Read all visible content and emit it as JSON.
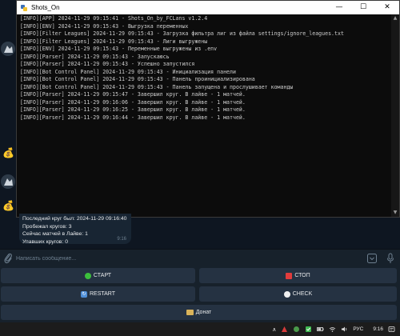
{
  "window": {
    "title": "Shots_On",
    "controls": {
      "minimize": "—",
      "maximize": "☐",
      "close": "✕"
    }
  },
  "console": {
    "lines": [
      "[INFO][APP] 2024-11-29 09:15:41 - Shots_On_by_FCLans v1.2.4",
      "[INFO][ENV] 2024-11-29 09:15:43 - Выгрузка переменных",
      "[INFO][Filter Leagues] 2024-11-29 09:15:43 - Загрузка фильтра лиг из файла settings/ignore_leagues.txt",
      "[INFO][Filter Leagues] 2024-11-29 09:15:43 - Лиги выгружены",
      "[INFO][ENV] 2024-11-29 09:15:43 - Переменные выгружены из .env",
      "[INFO][Parser] 2024-11-29 09:15:43 - Запускаюсь",
      "[INFO][Parser] 2024-11-29 09:15:43 - Успешно запустился",
      "[INFO][Bot Control Panel] 2024-11-29 09:15:43 - Инициализация панели",
      "[INFO][Bot Control Panel] 2024-11-29 09:15:43 - Панель проинициализирована",
      "[INFO][Bot Control Panel] 2024-11-29 09:15:43 - Панель запущена и прослушивает команды",
      "[INFO][Parser] 2024-11-29 09:15:47 - Завершил круг. В лайве - 1 матчей.",
      "[INFO][Parser] 2024-11-29 09:16:06 - Завершил круг. В лайве - 1 матчей.",
      "[INFO][Parser] 2024-11-29 09:16:25 - Завершил круг. В лайве - 1 матчей.",
      "[INFO][Parser] 2024-11-29 09:16:44 - Завершил круг. В лайве - 1 матчей."
    ]
  },
  "message": {
    "lines": [
      "Последний круг был: 2024-11-29 09:16:40",
      "Пробежал кругов: 3",
      "Сейчас матчей в Лайве: 1",
      "Упавших кругов: 0"
    ],
    "time": "9:16"
  },
  "composer": {
    "placeholder": "Написать сообщение..."
  },
  "keyboard": {
    "start": "СТАРТ",
    "stop": "СТОП",
    "restart": "RESTART",
    "check": "CHECK",
    "donate": "Донат"
  },
  "taskbar": {
    "language": "РУС",
    "time": "9:16"
  },
  "colors": {
    "chat_bg": "#0e1621",
    "panel_bg": "#17212b",
    "button_bg": "#253242",
    "console_bg": "#0c0c0c",
    "console_text": "#cccccc"
  }
}
